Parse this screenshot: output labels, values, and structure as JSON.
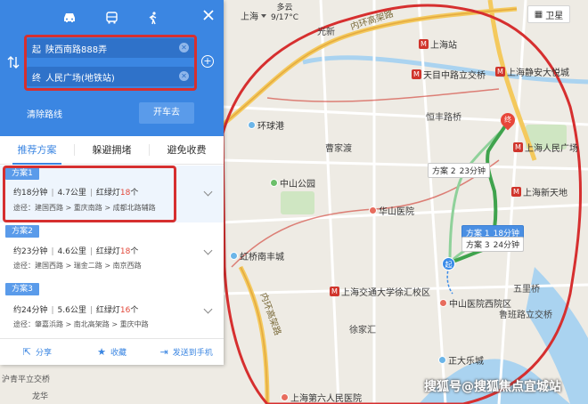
{
  "map": {
    "city": "上海",
    "weather": {
      "condition": "多云",
      "temperature": "9/17°C"
    },
    "satellite_label": "卫星",
    "labels": {
      "inner_ring_elevated_road": "内环高架路",
      "guangxin": "光新",
      "caoyangxincun": "曹杨新村",
      "shanghai_station": "上海站",
      "tianmuxilu_jiaochakou": "天目中路立交桥",
      "jingan_temple": "上海静安大悦城",
      "huangshi_bridge": "恒丰路桥",
      "huanqiu_port": "环球港",
      "caojiadu": "曹家渡",
      "people_square": "上海人民广场",
      "zhongshan_park": "中山公园",
      "huashan_hospital": "华山医院",
      "xintiandi": "上海新天地",
      "hongqiao_south": "虹桥南丰城",
      "sh_jiaotong": "上海交通大学徐汇校区",
      "zhongshan_hospital": "中山医院西院区",
      "xujiahui": "徐家汇",
      "wulitiao": "五里桥",
      "lupu_bridge": "鲁班路立交桥",
      "grand_theater": "正大乐城",
      "huping_bridge": "沪青平立交桥",
      "longhua": "龙华",
      "sixth_hospital": "上海第六人民医院",
      "inner_ring_elevated_road2": "内环高架路"
    },
    "route_tags": [
      {
        "name": "方案 2",
        "time": "23分钟"
      },
      {
        "name": "方案 1",
        "time": "18分钟"
      },
      {
        "name": "方案 3",
        "time": "24分钟"
      }
    ],
    "end_marker": "终",
    "start_marker": "起",
    "watermark": "搜狐号@搜狐焦点宜城站",
    "colors": {
      "route_primary": "#3fa34d",
      "route_alt": "#8fd19a",
      "red_highlight": "#d62f2f",
      "panel_blue": "#3b86e2"
    }
  },
  "panel": {
    "modes": [
      "car-icon",
      "bus-icon",
      "walk-icon"
    ],
    "start_label": "起",
    "start_value": "陕西南路888弄",
    "end_label": "终",
    "end_value": "人民广场(地铁站)",
    "clear_route": "清除路线",
    "go_button": "开车去",
    "tabs": [
      "推荐方案",
      "躲避拥堵",
      "避免收费"
    ],
    "plans": [
      {
        "tag": "方案1",
        "time": "约18分钟",
        "distance": "4.7公里",
        "lights_label": "红绿灯",
        "lights": "18",
        "lights_unit": "个",
        "via": "途径：建国西路 > 重庆南路 > 成都北路辅路"
      },
      {
        "tag": "方案2",
        "time": "约23分钟",
        "distance": "4.6公里",
        "lights_label": "红绿灯",
        "lights": "18",
        "lights_unit": "个",
        "via": "途径：建国西路 > 瑞金二路 > 南京西路"
      },
      {
        "tag": "方案3",
        "time": "约24分钟",
        "distance": "5.6公里",
        "lights_label": "红绿灯",
        "lights": "16",
        "lights_unit": "个",
        "via": "途径：肇嘉浜路 > 南北高架路 > 重庆中路"
      }
    ],
    "actions": [
      "分享",
      "收藏",
      "发送到手机"
    ]
  }
}
